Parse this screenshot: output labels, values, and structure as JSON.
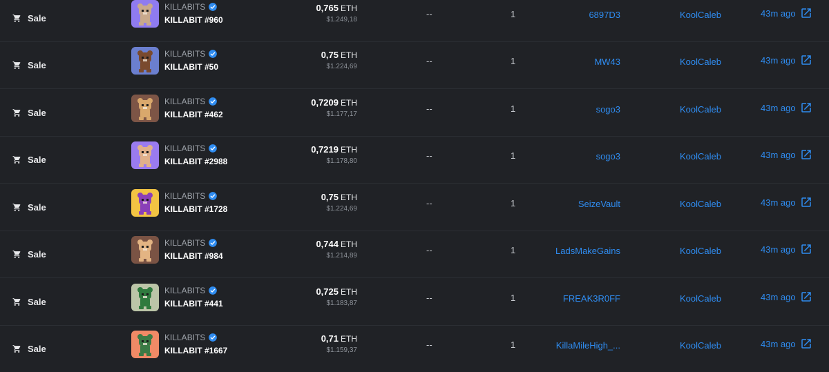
{
  "rows": [
    {
      "event": "Sale",
      "collection": "KILLABITS",
      "item": "KILLABIT #960",
      "price_eth": "0,765",
      "currency": "ETH",
      "price_usd": "$1.249,18",
      "unit_price": "--",
      "quantity": "1",
      "from": "6897D3",
      "to": "KoolCaleb",
      "time": "43m ago",
      "thumb_bg": "#8f7bf0",
      "bear_color": "#c9a98c"
    },
    {
      "event": "Sale",
      "collection": "KILLABITS",
      "item": "KILLABIT #50",
      "price_eth": "0,75",
      "currency": "ETH",
      "price_usd": "$1.224,69",
      "unit_price": "--",
      "quantity": "1",
      "from": "MW43",
      "to": "KoolCaleb",
      "time": "43m ago",
      "thumb_bg": "#6b7fcf",
      "bear_color": "#7a4a2e"
    },
    {
      "event": "Sale",
      "collection": "KILLABITS",
      "item": "KILLABIT #462",
      "price_eth": "0,7209",
      "currency": "ETH",
      "price_usd": "$1.177,17",
      "unit_price": "--",
      "quantity": "1",
      "from": "sogo3",
      "to": "KoolCaleb",
      "time": "43m ago",
      "thumb_bg": "#7d5546",
      "bear_color": "#d9a86c"
    },
    {
      "event": "Sale",
      "collection": "KILLABITS",
      "item": "KILLABIT #2988",
      "price_eth": "0,7219",
      "currency": "ETH",
      "price_usd": "$1.178,80",
      "unit_price": "--",
      "quantity": "1",
      "from": "sogo3",
      "to": "KoolCaleb",
      "time": "43m ago",
      "thumb_bg": "#9a7bf0",
      "bear_color": "#e0b08a"
    },
    {
      "event": "Sale",
      "collection": "KILLABITS",
      "item": "KILLABIT #1728",
      "price_eth": "0,75",
      "currency": "ETH",
      "price_usd": "$1.224,69",
      "unit_price": "--",
      "quantity": "1",
      "from": "SeizeVault",
      "to": "KoolCaleb",
      "time": "43m ago",
      "thumb_bg": "#f2c443",
      "bear_color": "#8a3fb8"
    },
    {
      "event": "Sale",
      "collection": "KILLABITS",
      "item": "KILLABIT #984",
      "price_eth": "0,744",
      "currency": "ETH",
      "price_usd": "$1.214,89",
      "unit_price": "--",
      "quantity": "1",
      "from": "LadsMakeGains",
      "to": "KoolCaleb",
      "time": "43m ago",
      "thumb_bg": "#7a5344",
      "bear_color": "#e3b483"
    },
    {
      "event": "Sale",
      "collection": "KILLABITS",
      "item": "KILLABIT #441",
      "price_eth": "0,725",
      "currency": "ETH",
      "price_usd": "$1.183,87",
      "unit_price": "--",
      "quantity": "1",
      "from": "FREAK3R0FF",
      "to": "KoolCaleb",
      "time": "43m ago",
      "thumb_bg": "#bcc5a8",
      "bear_color": "#2f7a3e"
    },
    {
      "event": "Sale",
      "collection": "KILLABITS",
      "item": "KILLABIT #1667",
      "price_eth": "0,71",
      "currency": "ETH",
      "price_usd": "$1.159,37",
      "unit_price": "--",
      "quantity": "1",
      "from": "KillaMileHigh_...",
      "to": "KoolCaleb",
      "time": "43m ago",
      "thumb_bg": "#f08a66",
      "bear_color": "#3b7a45"
    }
  ],
  "icons": {
    "event": "shopping-cart-icon",
    "verified": "verified-badge-icon",
    "external": "external-link-icon"
  },
  "colors": {
    "background": "#202226",
    "link": "#2f8cf0",
    "verified": "#2f8cf0"
  }
}
